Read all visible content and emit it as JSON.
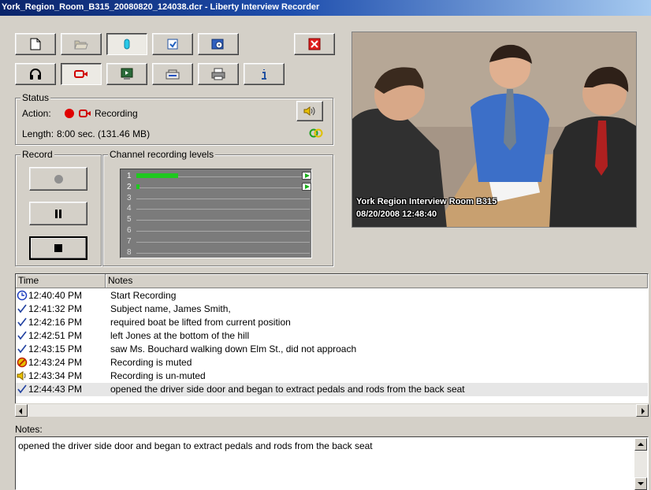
{
  "window": {
    "title": "York_Region_Room_B315_20080820_124038.dcr - Liberty Interview Recorder"
  },
  "toolbar": {
    "row1": [
      "new-document-icon",
      "open-folder-icon",
      "add-marker-icon",
      "export-icon",
      "burn-disc-icon",
      "close-icon"
    ],
    "row2": [
      "headphones-icon",
      "record-camera-icon",
      "play-export-icon",
      "properties-icon",
      "printer-icon",
      "information-icon"
    ]
  },
  "status": {
    "group_label": "Status",
    "action_label": "Action:",
    "action_value": "Recording",
    "length_label": "Length:",
    "length_value": "8:00 sec. (131.46 MB)",
    "record_color": "#e00000"
  },
  "record": {
    "group_label": "Record",
    "buttons": [
      "record-icon",
      "pause-icon",
      "stop-icon"
    ]
  },
  "levels": {
    "group_label": "Channel recording levels",
    "channels": [
      "1",
      "2",
      "3",
      "4",
      "5",
      "6",
      "7",
      "8"
    ],
    "values": [
      0.25,
      0.02,
      0,
      0,
      0,
      0,
      0,
      0
    ],
    "bar_color": "#1fc81f"
  },
  "video": {
    "caption": "York Region Interview Room B315",
    "timestamp": "08/20/2008 12:48:40"
  },
  "table": {
    "columns": [
      "Time",
      "Notes"
    ],
    "rows": [
      {
        "icon": "clock-icon",
        "time": "12:40:40 PM",
        "note": "Start Recording"
      },
      {
        "icon": "check-icon",
        "time": "12:41:32 PM",
        "note": "Subject name, James Smith,"
      },
      {
        "icon": "check-icon",
        "time": "12:42:16 PM",
        "note": "required boat be lifted from current position"
      },
      {
        "icon": "check-icon",
        "time": "12:42:51 PM",
        "note": "left Jones at the bottom of the hill"
      },
      {
        "icon": "check-icon",
        "time": "12:43:15 PM",
        "note": "saw Ms. Bouchard walking down Elm St., did not approach"
      },
      {
        "icon": "mute-icon",
        "time": "12:43:24 PM",
        "note": "Recording is muted"
      },
      {
        "icon": "speaker-icon",
        "time": "12:43:34 PM",
        "note": "Recording is un-muted"
      },
      {
        "icon": "check-icon",
        "time": "12:44:43 PM",
        "note": "opened the driver side door and began to extract pedals and rods from the back seat"
      }
    ]
  },
  "notes": {
    "label": "Notes:",
    "value": "opened the driver side door and began to extract pedals and rods from the back seat"
  }
}
